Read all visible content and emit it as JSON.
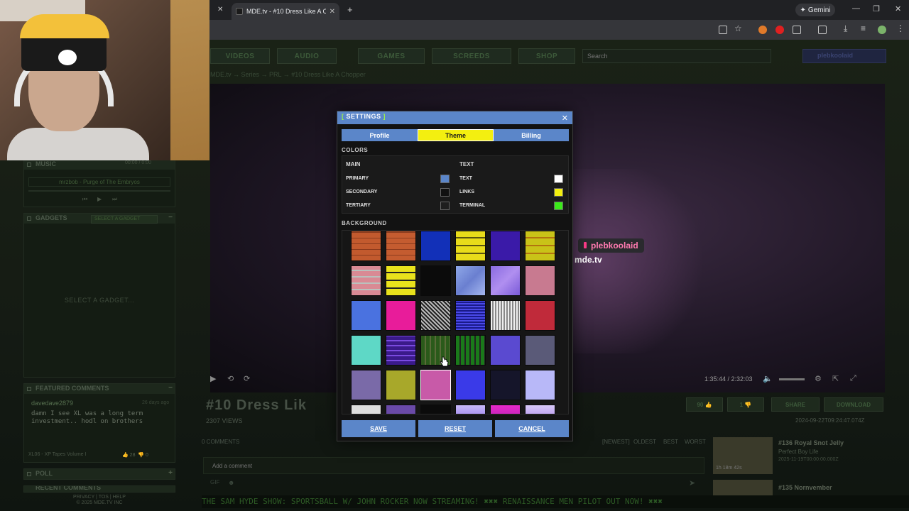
{
  "browser": {
    "tab_title": "MDE.tv - #10 Dress Like A C",
    "gemini_label": "Gemini"
  },
  "site": {
    "nav": [
      "VIDEOS",
      "AUDIO",
      "GAMES",
      "SCREEDS",
      "SHOP"
    ],
    "search_placeholder": "Search",
    "username": "plebkoolaid",
    "breadcrumb": "MDE.tv  →  Series  →  PRL  →  #10 Dress Like A Chopper"
  },
  "left": {
    "music_title": "MUSIC",
    "music_time": "00:00 / 0:00",
    "music_track": "mrzbob - Purge of The Embryos",
    "gadgets_title": "GADGETS",
    "gadget_select": "SELECT A GADGET",
    "gadget_empty": "SELECT A GADGET...",
    "featured_title": "FEATURED COMMENTS",
    "fc_user": "davedave2879",
    "fc_ago": "26 days ago",
    "fc_text": "damn I see XL was a long term investment.. hodl on brothers",
    "fc_source": "XL06 - XP Tapes Volume I",
    "fc_up": "28",
    "fc_down": "0",
    "poll_title": "POLL",
    "recent_title": "RECENT COMMENTS",
    "footer1": "PRIVACY | TOS | HELP",
    "footer2": "© 2025 MDE.TV INC"
  },
  "video": {
    "overlay_name": "plebkoolaid",
    "overlay_site": "mde.tv",
    "time": "1:35:44 / 2:32:03",
    "title": "#10 Dress Lik",
    "views": "2307 VIEWS",
    "date": "2024-09-22T09:24:47.074Z",
    "likes": "90",
    "dislikes": "1",
    "share": "SHARE",
    "download": "DOWNLOAD"
  },
  "comments": {
    "count": "0 COMMENTS",
    "sort": [
      "[NEWEST]",
      "OLDEST",
      "BEST",
      "WORST"
    ],
    "placeholder": "Add a comment"
  },
  "related": [
    {
      "title": "#136 Royal Snot Jelly",
      "sub": "Perfect Boy Life",
      "date": "2025-11-19T00:00:00.000Z",
      "dur": "1h 18m 42s"
    },
    {
      "title": "#135 Nornvember",
      "sub": "",
      "date": "",
      "dur": ""
    }
  ],
  "ticker": "THE SAM HYDE SHOW: SPORTSBALL W/ JOHN ROCKER NOW STREAMING!  ✖✖✖  RENAISSANCE MEN PILOT OUT NOW!  ✖✖✖",
  "modal": {
    "title": "SETTINGS",
    "tabs": [
      "Profile",
      "Theme",
      "Billing"
    ],
    "active_tab": "Theme",
    "colors_heading": "COLORS",
    "main_heading": "MAIN",
    "text_heading": "TEXT",
    "main_colors": [
      {
        "label": "PRIMARY",
        "color": "#5b86c9"
      },
      {
        "label": "SECONDARY",
        "color": "#111111"
      },
      {
        "label": "TERTIARY",
        "color": "#1e1e1e"
      }
    ],
    "text_colors": [
      {
        "label": "TEXT",
        "color": "#ffffff"
      },
      {
        "label": "LINKS",
        "color": "#f3ef10"
      },
      {
        "label": "TERMINAL",
        "color": "#3bea1a"
      }
    ],
    "background_heading": "BACKGROUND",
    "buttons": {
      "save": "SAVE",
      "reset": "RESET",
      "cancel": "CANCEL"
    }
  }
}
